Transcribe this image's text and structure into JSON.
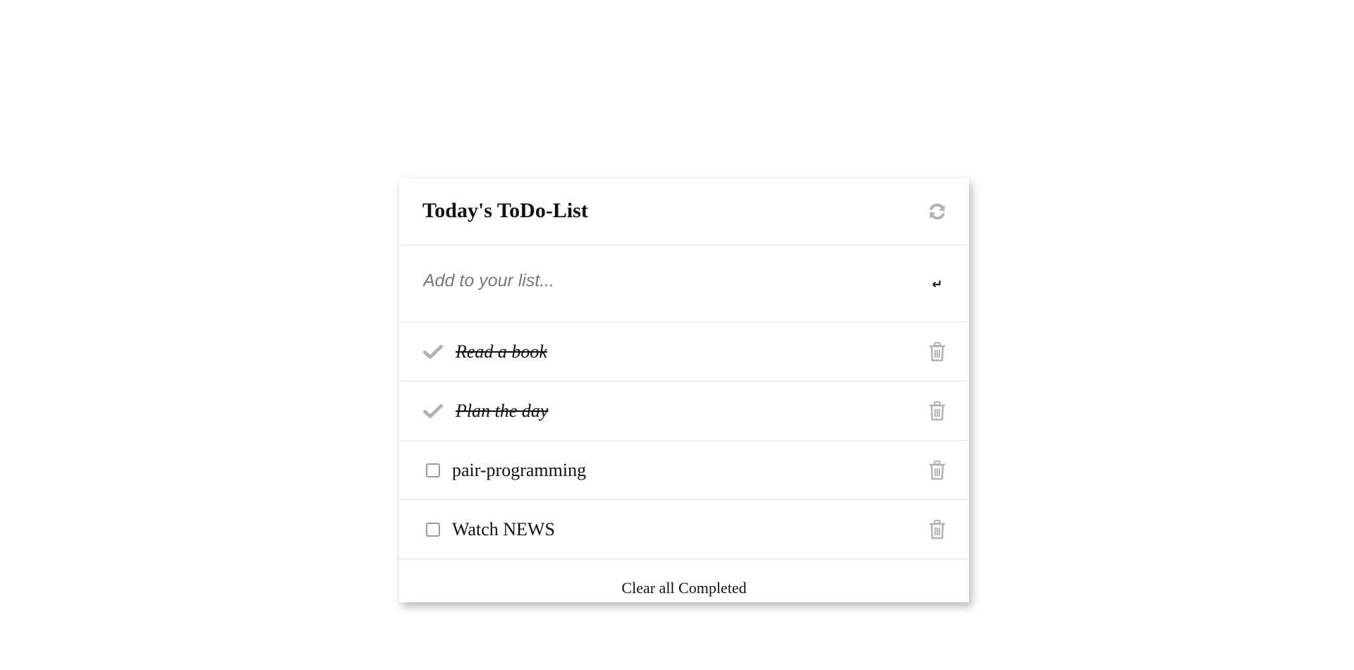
{
  "header": {
    "title": "Today's ToDo-List",
    "refresh_icon": "refresh-icon"
  },
  "add": {
    "placeholder": "Add to your list...",
    "value": "",
    "enter_icon": "↵"
  },
  "todos": [
    {
      "text": "Read a book",
      "completed": true
    },
    {
      "text": "Plan the day",
      "completed": true
    },
    {
      "text": "pair-programming",
      "completed": false
    },
    {
      "text": "Watch NEWS",
      "completed": false
    }
  ],
  "footer": {
    "clear_label": "Clear all Completed"
  },
  "colors": {
    "icon_gray": "#b3b3b3",
    "divider": "#e6e6e6"
  }
}
